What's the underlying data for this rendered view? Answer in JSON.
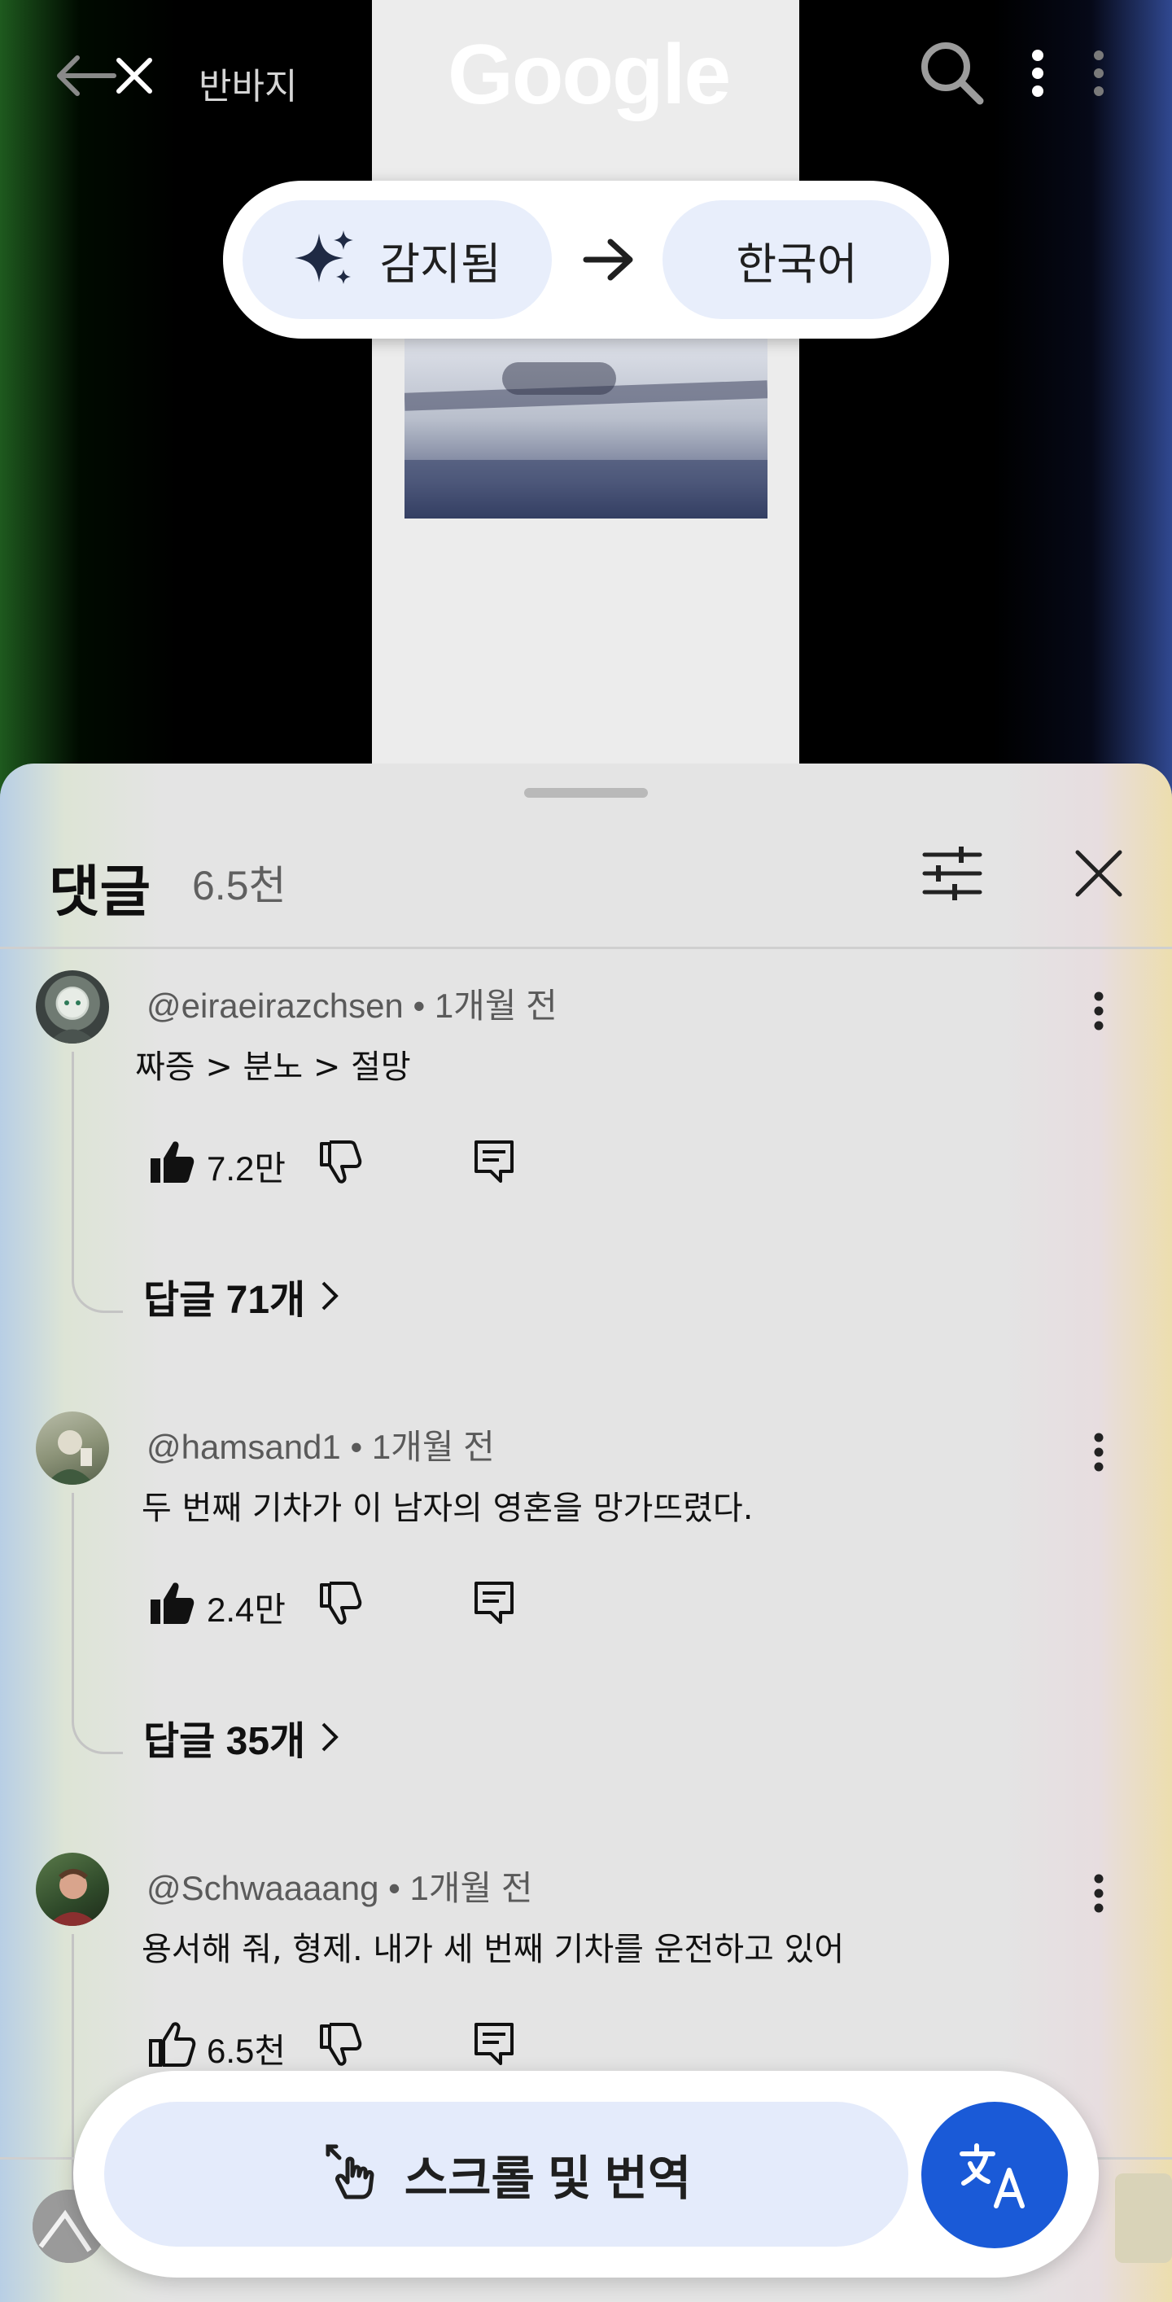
{
  "topbar": {
    "query": "반바지",
    "logo": "Google"
  },
  "language": {
    "source_label": "감지됨",
    "target_label": "한국어"
  },
  "comments_sheet": {
    "title": "댓글",
    "count": "6.5천",
    "comments": [
      {
        "author": "@eiraeirazchsen",
        "time": "1개월 전",
        "text": "짜증 > 분노 > 절망",
        "likes": "7.2만",
        "liked": true,
        "replies_label": "답글 71개"
      },
      {
        "author": "@hamsand1",
        "time": "1개월 전",
        "text": "두 번째 기차가 이 남자의 영혼을 망가뜨렸다.",
        "likes": "2.4만",
        "liked": true,
        "replies_label": "답글 35개"
      },
      {
        "author": "@Schwaaaang",
        "time": "1개월 전",
        "text": "용서해 줘, 형제. 내가 세 번째 기차를 운전하고 있어",
        "likes": "6.5천",
        "liked": false
      }
    ]
  },
  "bottom_bar": {
    "scroll_translate_label": "스크롤 및 번역"
  },
  "colors": {
    "accent_blue": "#1a5ad7",
    "chip_bg": "#e8eefb",
    "sheet_bg": "#e4e4e4"
  },
  "icons": [
    "back-arrow-icon",
    "close-icon",
    "search-icon",
    "more-vert-icon",
    "sparkle-icon",
    "arrow-right-icon",
    "filter-icon",
    "thumb-up-icon",
    "thumb-down-icon",
    "reply-icon",
    "chevron-right-icon",
    "touch-scroll-icon",
    "translate-icon"
  ]
}
